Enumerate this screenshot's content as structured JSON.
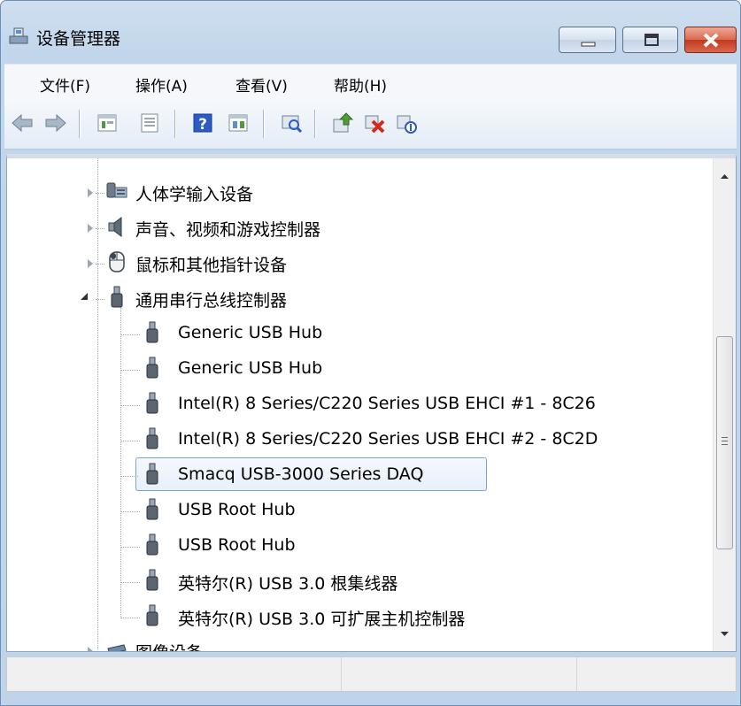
{
  "window": {
    "title": "设备管理器",
    "colors": {
      "accent": "#c2d6eb",
      "close": "#c23a1d",
      "selection_border": "#7da2ce"
    }
  },
  "menu": {
    "items": [
      "文件(F)",
      "操作(A)",
      "查看(V)",
      "帮助(H)"
    ]
  },
  "toolbar": {
    "buttons": [
      "back-arrow-icon",
      "forward-arrow-icon",
      "properties-view-icon",
      "print-icon",
      "help-icon",
      "show-hidden-icon",
      "scan-hardware-icon",
      "update-driver-icon",
      "uninstall-device-icon",
      "disable-device-icon"
    ]
  },
  "tree": {
    "categories": [
      {
        "label": "人体学输入设备",
        "icon": "keyboard-hid-icon",
        "expanded": false
      },
      {
        "label": "声音、视频和游戏控制器",
        "icon": "speaker-icon",
        "expanded": false
      },
      {
        "label": "鼠标和其他指针设备",
        "icon": "mouse-icon",
        "expanded": false
      },
      {
        "label": "通用串行总线控制器",
        "icon": "usb-plug-icon",
        "expanded": true
      },
      {
        "label": "图像设备",
        "icon": "scanner-icon",
        "expanded": false
      }
    ],
    "usb_children": [
      {
        "label": "Generic USB Hub",
        "selected": false
      },
      {
        "label": "Generic USB Hub",
        "selected": false
      },
      {
        "label": "Intel(R) 8 Series/C220 Series USB EHCI #1 - 8C26",
        "selected": false
      },
      {
        "label": "Intel(R) 8 Series/C220 Series USB EHCI #2 - 8C2D",
        "selected": false
      },
      {
        "label": "Smacq USB-3000 Series DAQ",
        "selected": true
      },
      {
        "label": "USB Root Hub",
        "selected": false
      },
      {
        "label": "USB Root Hub",
        "selected": false
      },
      {
        "label": "英特尔(R) USB 3.0 根集线器",
        "selected": false
      },
      {
        "label": "英特尔(R) USB 3.0 可扩展主机控制器",
        "selected": false
      }
    ]
  },
  "statusbar": {
    "panes": [
      "",
      "",
      ""
    ]
  }
}
